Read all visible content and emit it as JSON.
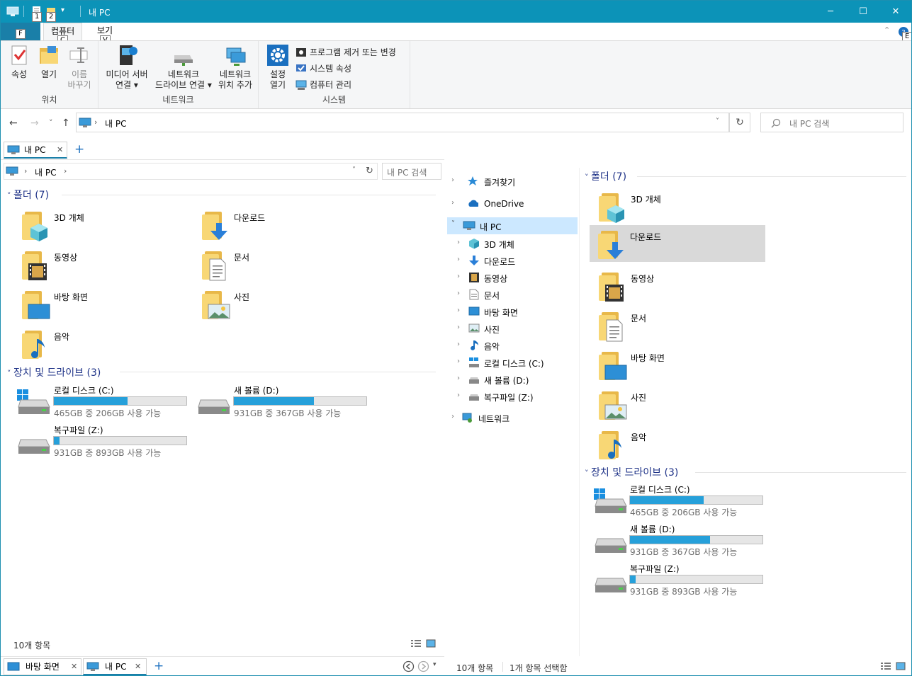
{
  "window": {
    "title": "내 PC",
    "minimize": "─",
    "maximize": "☐",
    "close": "✕"
  },
  "keytips": {
    "file": "F",
    "q1": "1",
    "q2": "2",
    "computer": "C",
    "view": "V",
    "help": "E"
  },
  "tabs": {
    "file": "F",
    "computer": "컴퓨터",
    "view": "보기"
  },
  "ribbon": {
    "location": {
      "label": "위치",
      "properties": "속성",
      "open": "열기",
      "rename1": "이름",
      "rename2": "바꾸기"
    },
    "network": {
      "label": "네트워크",
      "media1": "미디어 서버",
      "media2": "연결 ▾",
      "netdrive1": "네트워크",
      "netdrive2": "드라이브 연결 ▾",
      "netloc1": "네트워크",
      "netloc2": "위치 추가"
    },
    "system": {
      "label": "시스템",
      "settings1": "설정",
      "settings2": "열기",
      "uninstall": "프로그램 제거 또는 변경",
      "sysprops": "시스템 속성",
      "manage": "컴퓨터 관리"
    }
  },
  "nav": {
    "back": "←",
    "forward": "→",
    "recent": "˅",
    "up": "↑",
    "address": "내 PC",
    "refresh": "↻",
    "search_placeholder": "내 PC 검색"
  },
  "leftpane": {
    "tab_label": "내 PC",
    "tab_close": "✕",
    "tab_add": "+",
    "address": "내 PC",
    "search": "내 PC 검색",
    "folders_header": "폴더 (7)",
    "devices_header": "장치 및 드라이브 (3)",
    "status": "10개 항목"
  },
  "folders": [
    "3D 개체",
    "다운로드",
    "동영상",
    "문서",
    "바탕 화면",
    "사진",
    "음악"
  ],
  "drives": [
    {
      "name": "로컬 디스크 (C:)",
      "free": "465GB 중 206GB 사용 가능",
      "used": 0.557
    },
    {
      "name": "새 볼륨 (D:)",
      "free": "931GB 중 367GB 사용 가능",
      "used": 0.606
    },
    {
      "name": "복구파일 (Z:)",
      "free": "931GB 중 893GB 사용 가능",
      "used": 0.041
    }
  ],
  "tree": {
    "favorites": "즐겨찾기",
    "onedrive": "OneDrive",
    "thispc": "내 PC",
    "items": [
      "3D 개체",
      "다운로드",
      "동영상",
      "문서",
      "바탕 화면",
      "사진",
      "음악",
      "로컬 디스크 (C:)",
      "새 볼륨 (D:)",
      "복구파일 (Z:)"
    ],
    "network": "네트워크"
  },
  "rightpane": {
    "folders_header": "폴더 (7)",
    "devices_header": "장치 및 드라이브 (3)",
    "status_count": "10개 항목",
    "status_selected": "1개 항목 선택함"
  },
  "bottomtabs": {
    "desktop": "바탕 화면",
    "thispc": "내 PC",
    "close": "✕",
    "add": "+"
  },
  "colors": {
    "titlebar": "#0c93b8",
    "accent": "#1a7fa8",
    "bar_fill": "#26a0da",
    "header_text": "#1e3287",
    "selection": "#cce8ff"
  }
}
